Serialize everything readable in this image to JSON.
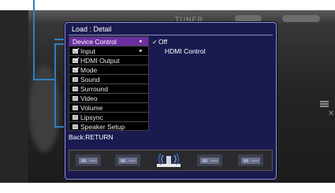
{
  "background": {
    "source_label": "TUNER"
  },
  "dialog": {
    "title": "Load : Detail",
    "back_text": "Back:RETURN"
  },
  "menu": {
    "items": [
      {
        "label": "Device Control",
        "selected": true,
        "checkbox": false,
        "has_submenu": true
      },
      {
        "label": "Input",
        "selected": false,
        "checkbox": true,
        "checked": true,
        "has_submenu": true
      },
      {
        "label": "HDMI Output",
        "selected": false,
        "checkbox": true,
        "checked": true
      },
      {
        "label": "Mode",
        "selected": false,
        "checkbox": true,
        "checked": true
      },
      {
        "label": "Sound",
        "selected": false,
        "checkbox": true,
        "checked": false
      },
      {
        "label": "Surround",
        "selected": false,
        "checkbox": true,
        "checked": false
      },
      {
        "label": "Video",
        "selected": false,
        "checkbox": true,
        "checked": false
      },
      {
        "label": "Volume",
        "selected": false,
        "checkbox": true,
        "checked": false
      },
      {
        "label": "Lipsync",
        "selected": false,
        "checkbox": true,
        "checked": false
      },
      {
        "label": "Speaker Setup",
        "selected": false,
        "checkbox": true,
        "checked": false
      }
    ],
    "submenu_arrow": "►"
  },
  "options": {
    "items": [
      {
        "label": "Off",
        "checked": true
      },
      {
        "label": "HDMI Control",
        "checked": false
      }
    ],
    "check_glyph": "✓"
  },
  "thumbnails": [
    {
      "name": "thumb-1",
      "icon": "device-icon",
      "highlighted": false
    },
    {
      "name": "thumb-2",
      "icon": "device-icon",
      "highlighted": false
    },
    {
      "name": "thumb-3",
      "icon": "speaker-signal-icon",
      "highlighted": true
    },
    {
      "name": "thumb-4",
      "icon": "device-icon",
      "highlighted": false
    },
    {
      "name": "thumb-5",
      "icon": "device-icon",
      "highlighted": false
    }
  ],
  "colors": {
    "dialog_bg": "#1a1a50",
    "selected_bg": "#6c2ea0",
    "callout": "#2f7fc0"
  }
}
